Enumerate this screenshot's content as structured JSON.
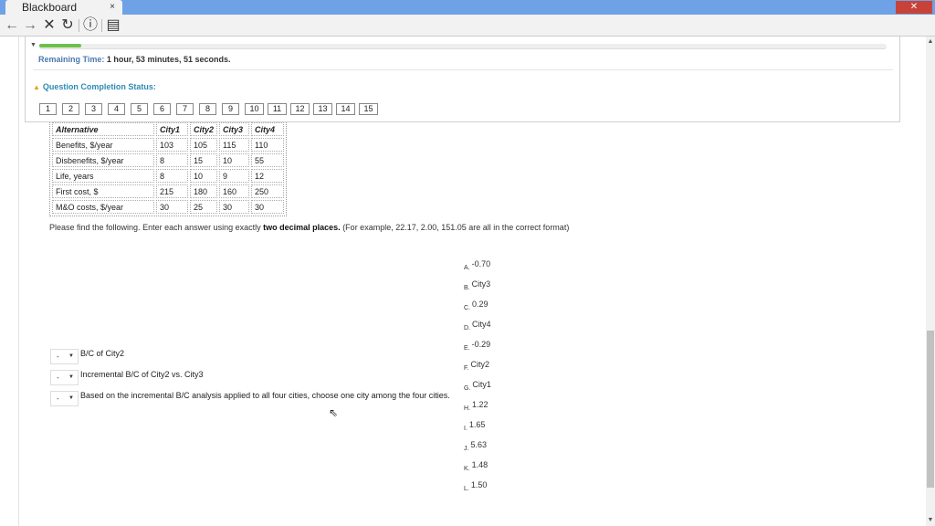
{
  "browser": {
    "tab_title": "Blackboard",
    "tab_close": "×",
    "window_close": "✕",
    "toolbar": {
      "back_glyph": "←",
      "forward_glyph": "→",
      "stop_glyph": "✕",
      "reload_glyph": "↻",
      "info_glyph": "ⓘ",
      "reader_glyph": "▤"
    }
  },
  "status": {
    "progress_fraction": 0.05,
    "progress_toggle": "▼",
    "remaining_label": "Remaining Time:",
    "remaining_hours": "1 hour,",
    "remaining_minutes": "53",
    "remaining_minutes_unit": "minutes,",
    "remaining_seconds": "51",
    "remaining_seconds_unit": "seconds.",
    "completion_chevron": "▲",
    "completion_label": "Question Completion Status:",
    "question_numbers": [
      "1",
      "2",
      "3",
      "4",
      "5",
      "6",
      "7",
      "8",
      "9",
      "10",
      "11",
      "12",
      "13",
      "14",
      "15"
    ]
  },
  "table": {
    "headers": [
      "Alternative",
      "City1",
      "City2",
      "City3",
      "City4"
    ],
    "rows": [
      [
        "Benefits, $/year",
        "103",
        "105",
        "115",
        "110"
      ],
      [
        "Disbenefits, $/year",
        "8",
        "15",
        "10",
        "55"
      ],
      [
        "Life, years",
        "8",
        "10",
        "9",
        "12"
      ],
      [
        "First cost, $",
        "215",
        "180",
        "160",
        "250"
      ],
      [
        "M&O costs, $/year",
        "30",
        "25",
        "30",
        "30"
      ]
    ]
  },
  "instruction": {
    "prefix": "Please find the following. Enter each answer using exactly ",
    "bold": "two decimal places.",
    "suffix": " (For example, 22.17, 2.00, 151.05 are all in the correct format)"
  },
  "answers": [
    {
      "letter": "A.",
      "value": "-0.70"
    },
    {
      "letter": "B.",
      "value": "City3"
    },
    {
      "letter": "C.",
      "value": "0.29"
    },
    {
      "letter": "D.",
      "value": "City4"
    },
    {
      "letter": "E.",
      "value": "-0.29"
    },
    {
      "letter": "F.",
      "value": "City2"
    },
    {
      "letter": "G.",
      "value": "City1"
    },
    {
      "letter": "H.",
      "value": "1.22"
    },
    {
      "letter": "I.",
      "value": "1.65"
    },
    {
      "letter": "J.",
      "value": "5.63"
    },
    {
      "letter": "K.",
      "value": "1.48"
    },
    {
      "letter": "L.",
      "value": "1.50"
    }
  ],
  "questions": [
    {
      "selected": "-",
      "text": "B/C of City2"
    },
    {
      "selected": "-",
      "text": "Incremental B/C of City2 vs. City3"
    },
    {
      "selected": "-",
      "text": "Based on the incremental B/C analysis applied to all four cities, choose one city among the four cities."
    }
  ],
  "select_arrow": "▼",
  "scroll_up": "▲",
  "scroll_down": "▼",
  "cursor_glyph": "⇖"
}
